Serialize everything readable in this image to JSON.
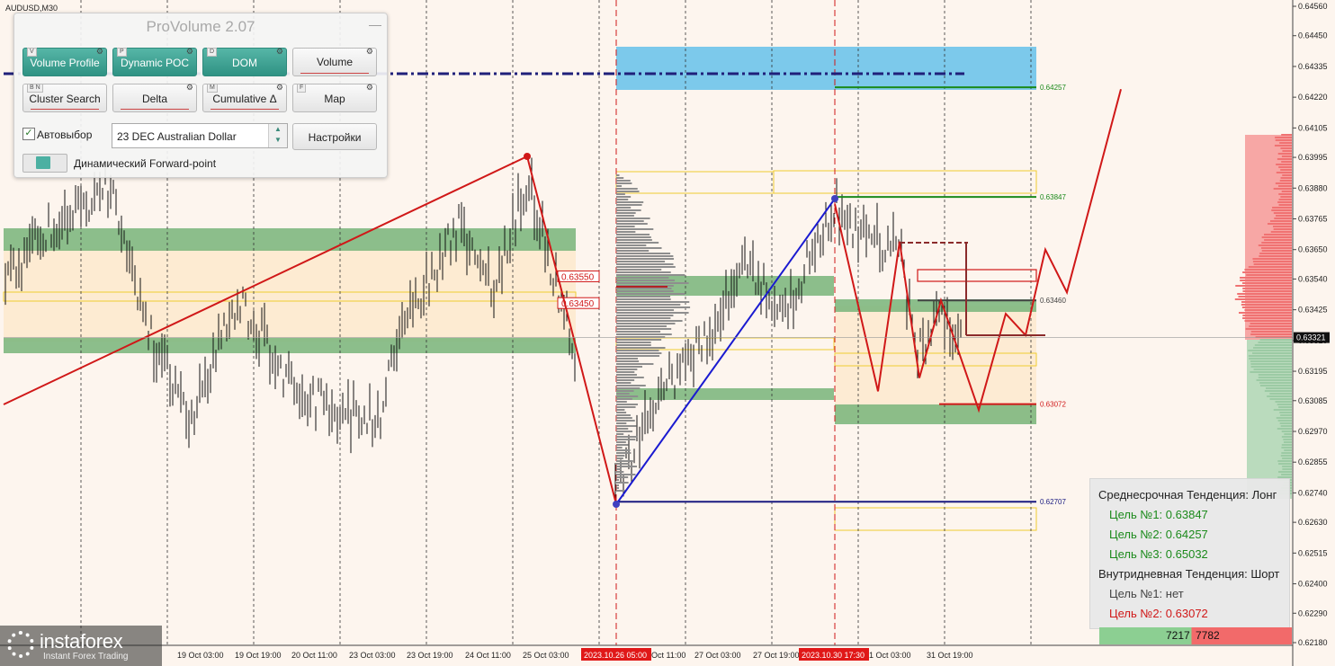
{
  "symbol_label": "AUDUSD,M30",
  "panel": {
    "title": "ProVolume 2.07",
    "minimize_glyph": "—",
    "buttons": [
      {
        "hotkey": "V",
        "label": "Volume Profile",
        "active": true
      },
      {
        "hotkey": "P",
        "label": "Dynamic POC",
        "active": true
      },
      {
        "hotkey": "D",
        "label": "DOM",
        "active": true
      },
      {
        "hotkey": "",
        "label": "Volume",
        "active": false
      },
      {
        "hotkey": "B N",
        "label": "Cluster Search",
        "active": false
      },
      {
        "hotkey": "",
        "label": "Delta",
        "active": false
      },
      {
        "hotkey": "M",
        "label": "Cumulative Δ",
        "active": false
      },
      {
        "hotkey": "F",
        "label": "Map",
        "active": false
      }
    ],
    "autoselect_label": "Автовыбор",
    "autoselect_checked": true,
    "check_glyph": "✓",
    "instrument": "23 DEC Australian Dollar",
    "settings_label": "Настройки",
    "forward_label": "Динамический Forward-point",
    "forward_enabled": true
  },
  "chart_data": {
    "type": "line",
    "title": "",
    "price_axis_ticks": [
      0.6456,
      0.6445,
      0.64335,
      0.6422,
      0.64105,
      0.63995,
      0.6388,
      0.63765,
      0.6365,
      0.6354,
      0.63425,
      0.6331,
      0.63195,
      0.63085,
      0.6297,
      0.62855,
      0.6274,
      0.6263,
      0.62515,
      0.624,
      0.6229,
      0.6218
    ],
    "time_axis_labels": [
      "19 Oct 03:00",
      "19 Oct 19:00",
      "20 Oct 11:00",
      "23 Oct 03:00",
      "23 Oct 19:00",
      "24 Oct 11:00",
      "25 Oct 03:00",
      "26 Oct 11:00",
      "27 Oct 03:00",
      "27 Oct 19:00",
      "31 Oct 03:00",
      "31 Oct 19:00"
    ],
    "time_axis_partial_labels": [
      "Oct 11:00",
      "Oct 11:00",
      "1 Oct 03:00"
    ],
    "highlighted_times": [
      "2023.10.26 05:00",
      "2023.10.30 17:30"
    ],
    "current_price": "0.63321",
    "level_labels": [
      {
        "text": "0.64257",
        "price": 0.64257,
        "color": "#1b8a1b"
      },
      {
        "text": "0.63847",
        "price": 0.63847,
        "color": "#1b8a1b"
      },
      {
        "text": "0.63460",
        "price": 0.6346,
        "color": "#444444"
      },
      {
        "text": "0.63072",
        "price": 0.63072,
        "color": "#d01818"
      },
      {
        "text": "0.62707",
        "price": 0.62707,
        "color": "#1a1a80"
      }
    ],
    "poc_labels": [
      {
        "text": "0.63550",
        "price": 0.6355
      },
      {
        "text": "0.63450",
        "price": 0.6345
      }
    ],
    "zigzag_lines": [
      {
        "name": "red-trend-1",
        "color": "#d01818",
        "points": [
          [
            0.6312,
            0
          ],
          [
            0.6398,
            1
          ]
        ]
      },
      {
        "name": "red-drop",
        "color": "#d01818",
        "points": [
          [
            0.6398,
            0
          ],
          [
            0.627,
            1
          ]
        ]
      },
      {
        "name": "blue-rise",
        "color": "#1a1ad0",
        "points": [
          [
            0.627,
            0
          ],
          [
            0.6382,
            1
          ]
        ]
      }
    ],
    "forecast_path": [
      0.6382,
      0.6312,
      0.6368,
      0.6317,
      0.6346,
      0.6305,
      0.6341,
      0.6333,
      0.6365,
      0.6349,
      0.6425
    ],
    "grid": true
  },
  "info_box": {
    "medium_term": "Среднесрочная Тенденция: Лонг",
    "target1": "Цель №1: 0.63847",
    "target2": "Цель №2: 0.64257",
    "target3": "Цель №3: 0.65032",
    "intraday": "Внутридневная Тенденция: Шорт",
    "intraday_target1": "Цель №1: нет",
    "intraday_target2": "Цель №2: 0.63072",
    "colors": {
      "long": "#1b8a1b",
      "short": "#d01818",
      "neutral": "#444444"
    }
  },
  "volume_counts": {
    "buy": "7217",
    "sell": "7782",
    "buy_fraction": 0.48
  },
  "watermark": {
    "brand": "instaforex",
    "tagline": "Instant Forex Trading"
  }
}
